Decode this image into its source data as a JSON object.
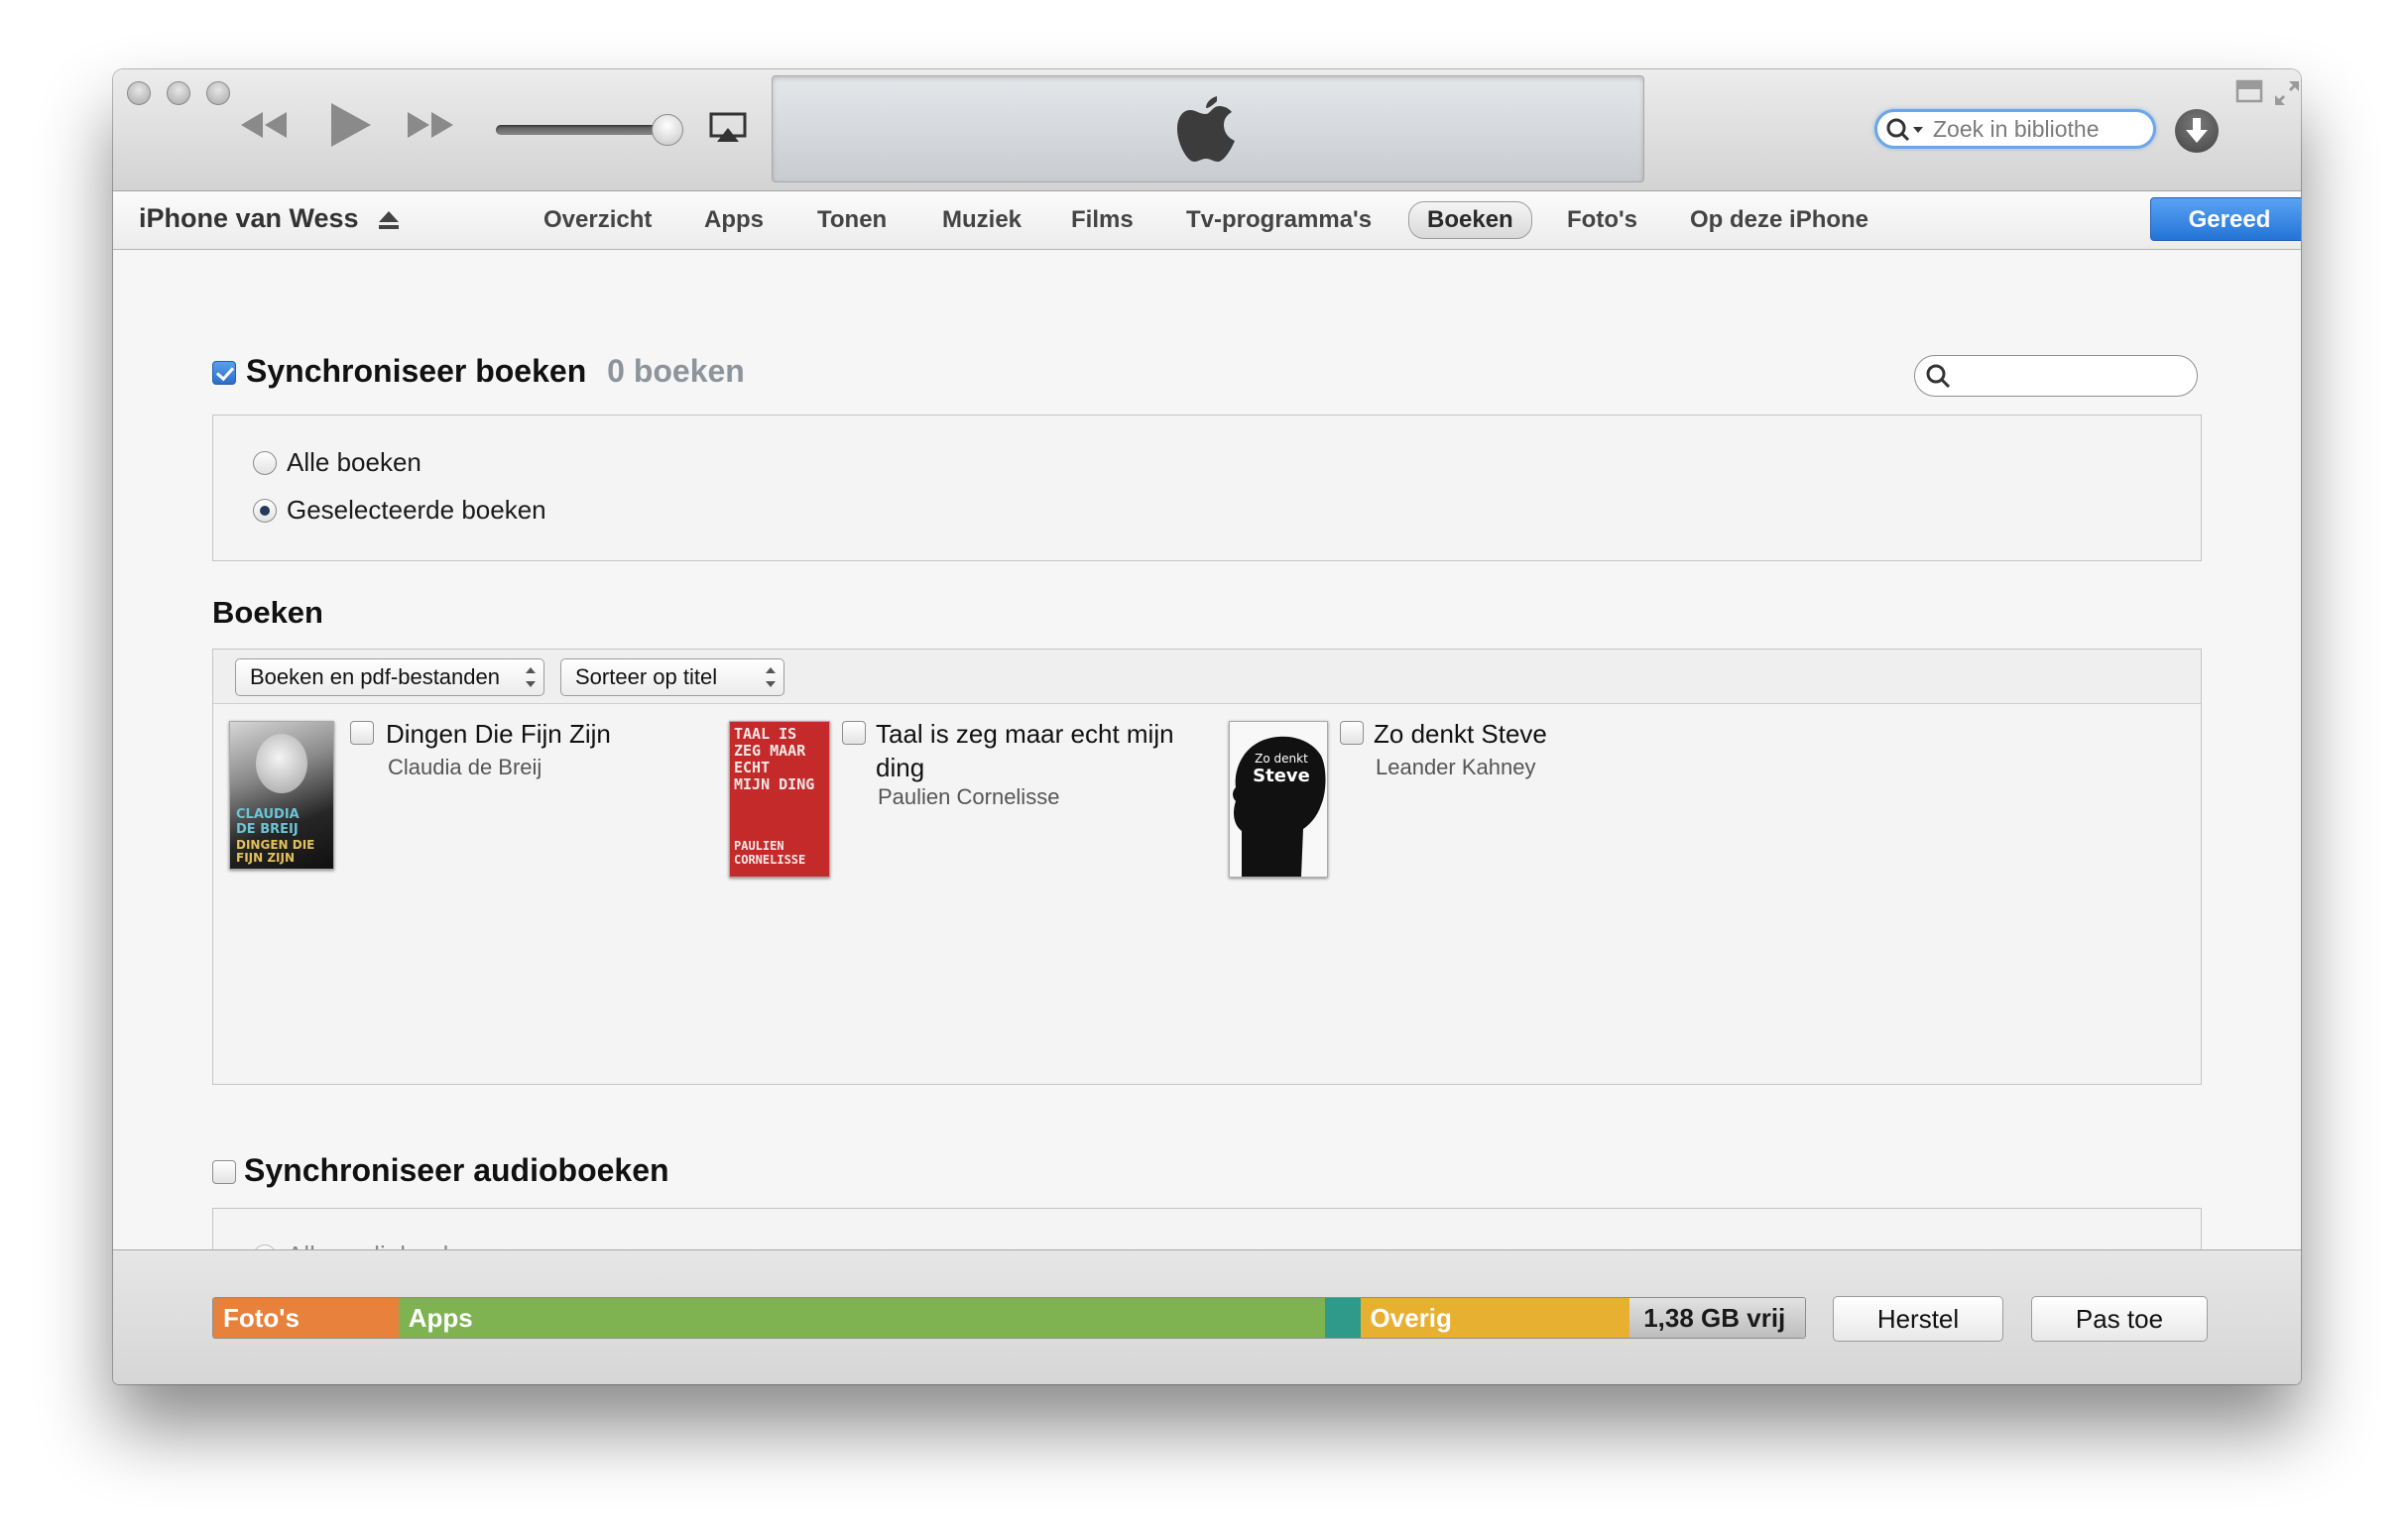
{
  "toolbar": {
    "traffic_lights": [
      "close",
      "minimize",
      "zoom"
    ],
    "controls": [
      "rewind-icon",
      "play-icon",
      "fast-forward-icon",
      "airplay-icon"
    ],
    "volume_level": 0.9,
    "lcd_icon": "apple-logo-icon",
    "search": {
      "placeholder": "Zoek in bibliothe",
      "value": ""
    },
    "download_icon": "download-icon"
  },
  "device": {
    "name": "iPhone van Wess",
    "eject_icon": "eject-icon"
  },
  "tabs": [
    {
      "label": "Overzicht",
      "active": false
    },
    {
      "label": "Apps",
      "active": false
    },
    {
      "label": "Tonen",
      "active": false
    },
    {
      "label": "Muziek",
      "active": false
    },
    {
      "label": "Films",
      "active": false
    },
    {
      "label": "Tv-programma's",
      "active": false
    },
    {
      "label": "Boeken",
      "active": true
    },
    {
      "label": "Foto's",
      "active": false
    },
    {
      "label": "Op deze iPhone",
      "active": false
    }
  ],
  "done_label": "Gereed",
  "sync_books": {
    "label": "Synchroniseer boeken",
    "checked": true,
    "count": "0 boeken",
    "options": [
      {
        "label": "Alle boeken",
        "selected": false
      },
      {
        "label": "Geselecteerde boeken",
        "selected": true
      }
    ]
  },
  "books_section": {
    "title": "Boeken",
    "filter_select": "Boeken en pdf-bestanden",
    "sort_select": "Sorteer op titel",
    "items": [
      {
        "title": "Dingen Die Fijn Zijn",
        "author": "Claudia de Breij",
        "checked": false
      },
      {
        "title": "Taal is zeg maar echt mijn ding",
        "author": "Paulien Cornelisse",
        "checked": false
      },
      {
        "title": "Zo denkt Steve",
        "author": "Leander Kahney",
        "checked": false
      }
    ],
    "covers": [
      {
        "text": [
          "CLAUDIA",
          "DE BREIJ",
          "DINGEN DIE",
          "FIJN ZIJN"
        ]
      },
      {
        "text": [
          "TAAL IS",
          "ZEG MAAR",
          "ECHT",
          "MIJN DING",
          "PAULIEN",
          "CORNELISSE"
        ]
      },
      {
        "text": [
          "Zo denkt",
          "Steve"
        ]
      }
    ]
  },
  "sync_audiobooks": {
    "label": "Synchroniseer audioboeken",
    "checked": false,
    "option": "Alle audioboeken"
  },
  "capacity": {
    "segments": [
      {
        "label": "Foto's",
        "color": "#e8813c"
      },
      {
        "label": "Apps",
        "color": "#7fb352"
      },
      {
        "label": "",
        "color": "#2f9a8a"
      },
      {
        "label": "Overig",
        "color": "#e8b030"
      },
      {
        "label": "1,38 GB vrij",
        "color": "#cfcfcf"
      }
    ]
  },
  "buttons": {
    "revert": "Herstel",
    "apply": "Pas toe"
  }
}
